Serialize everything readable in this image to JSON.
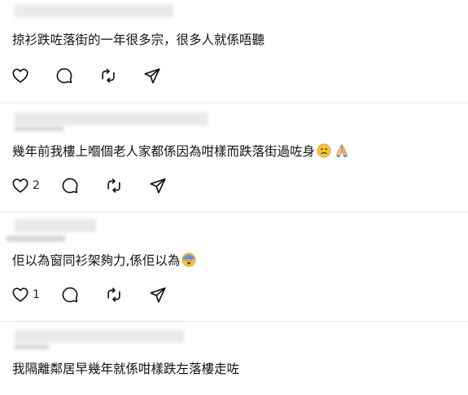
{
  "comments": [
    {
      "text": "掠衫跌咗落街的一年很多宗，很多人就係唔聽",
      "icons": [
        "heart-icon",
        "comment-icon",
        "repost-icon",
        "share-icon"
      ],
      "likes": ""
    },
    {
      "text": "幾年前我樓上嗰個老人家都係因為咁樣而跌落街過咗身",
      "text_suffix": "",
      "emojis": [
        "sad-face-emoji",
        "folded-hands-emoji"
      ],
      "icons": [
        "heart-icon",
        "comment-icon",
        "repost-icon",
        "share-icon"
      ],
      "likes": "2"
    },
    {
      "text": "佢以為窗同衫架夠力,係佢以為",
      "emojis": [
        "fearful-face-emoji"
      ],
      "icons": [
        "heart-icon",
        "comment-icon",
        "repost-icon",
        "share-icon"
      ],
      "likes": "1"
    },
    {
      "text": "我隔離鄰居早幾年就係咁樣跌左落樓走咗"
    }
  ]
}
